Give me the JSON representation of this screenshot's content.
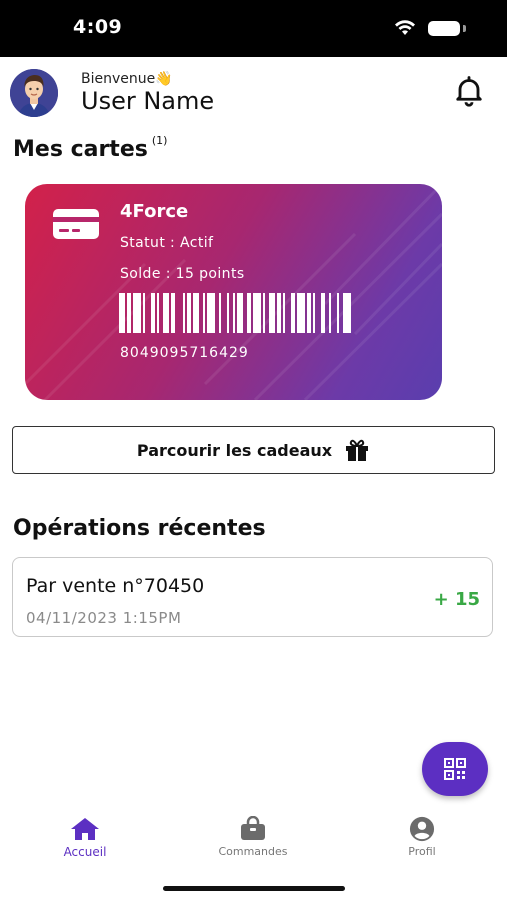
{
  "status_bar": {
    "time": "4:09"
  },
  "header": {
    "greeting": "Bienvenue👋",
    "user_name": "User Name"
  },
  "cards_section": {
    "title": "Mes cartes",
    "count": "(1)"
  },
  "card": {
    "name": "4Force",
    "status": "Statut : Actif",
    "balance": "Solde : 15 points",
    "number": "8049095716429"
  },
  "gifts_button": {
    "label": "Parcourir les cadeaux"
  },
  "operations_section": {
    "title": "Opérations récentes"
  },
  "operations": [
    {
      "title": "Par vente n°70450",
      "date": "04/11/2023 1:15PM",
      "points": "+ 15"
    }
  ],
  "bottom_nav": {
    "items": [
      {
        "label": "Accueil",
        "icon": "home-icon"
      },
      {
        "label": "Commandes",
        "icon": "bag-icon"
      },
      {
        "label": "Profil",
        "icon": "profile-icon"
      }
    ]
  },
  "colors": {
    "accent": "#5c2fc2",
    "positive": "#39a845"
  }
}
